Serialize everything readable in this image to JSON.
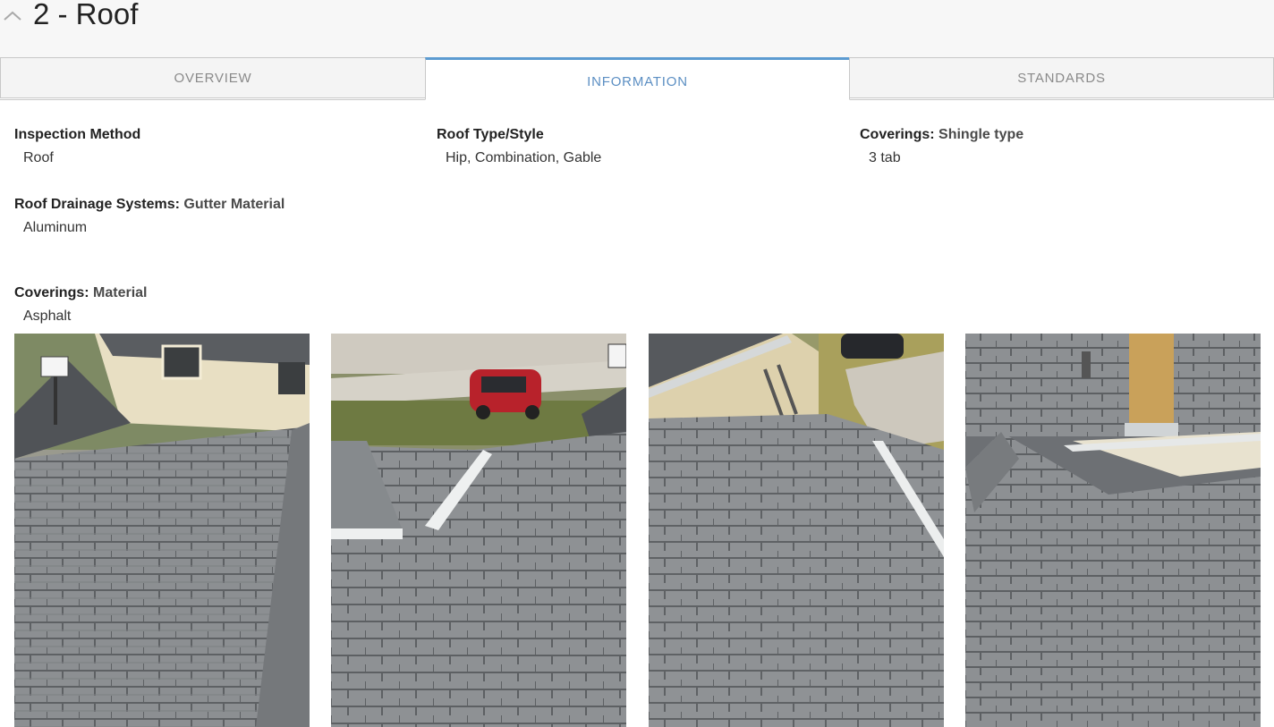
{
  "section": {
    "title": "2 - Roof",
    "collapse_icon": "chevron-up-icon"
  },
  "tabs": [
    {
      "label": "OVERVIEW",
      "active": false
    },
    {
      "label": "INFORMATION",
      "active": true
    },
    {
      "label": "STANDARDS",
      "active": false
    }
  ],
  "colors": {
    "accent": "#5c9bd1",
    "tab_active_text": "#5c8fc3",
    "tab_inactive_bg": "#f4f4f4"
  },
  "information": [
    {
      "label": "Inspection Method",
      "sublabel": "",
      "value": "Roof"
    },
    {
      "label": "Roof Type/Style",
      "sublabel": "",
      "value": "Hip, Combination, Gable"
    },
    {
      "label": "Coverings:",
      "sublabel": "Shingle type",
      "value": "3 tab"
    },
    {
      "label": "Roof Drainage Systems:",
      "sublabel": "Gutter Material",
      "value": "Aluminum"
    },
    {
      "label": "Coverings:",
      "sublabel": "Material",
      "value": "Asphalt"
    }
  ],
  "photos": [
    "roof-photo",
    "roof-photo",
    "roof-photo",
    "roof-photo"
  ]
}
